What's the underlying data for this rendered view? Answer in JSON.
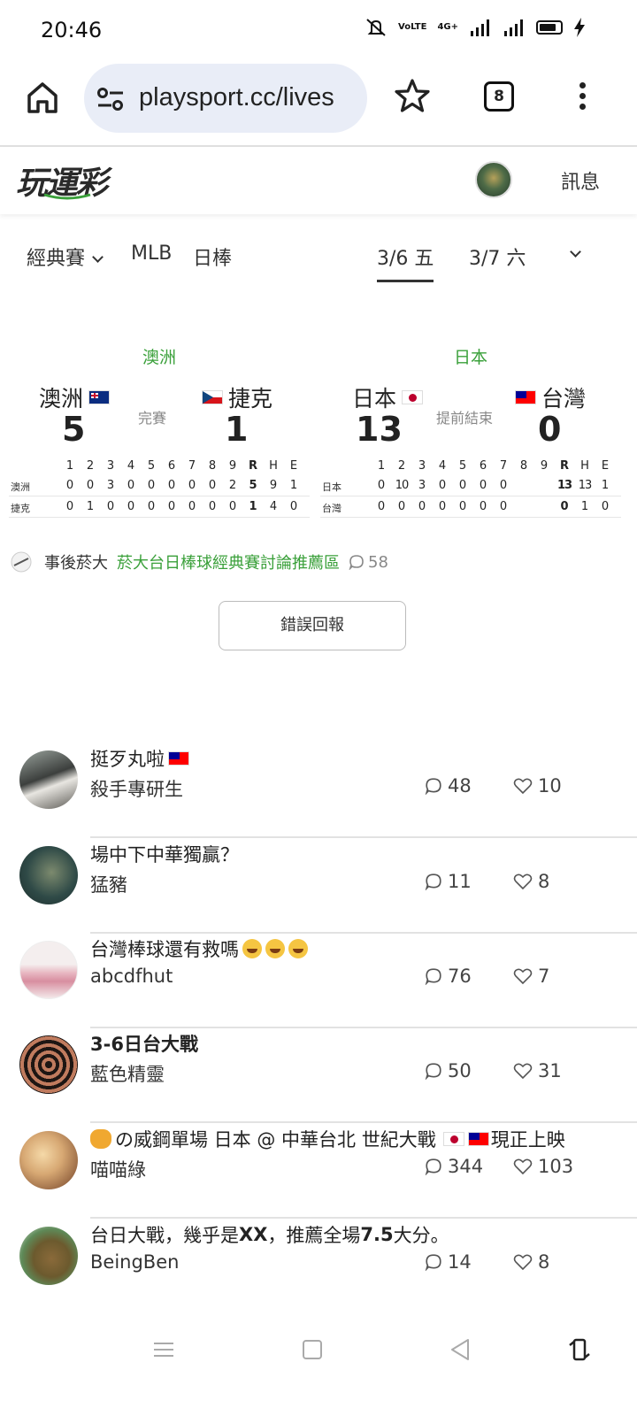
{
  "status": {
    "time": "20:46",
    "network_a": "VoLTE",
    "network_b": "4G+"
  },
  "browser": {
    "url": "playsport.cc/lives",
    "tab_count": "8"
  },
  "site": {
    "logo": "玩運彩",
    "messages_label": "訊息"
  },
  "filters": {
    "league": "經典賽",
    "mlb": "MLB",
    "npb": "日棒",
    "date_active": "3/6 五",
    "date_next": "3/7 六"
  },
  "games": [
    {
      "league": "澳洲",
      "away": "澳洲",
      "home": "捷克",
      "away_score": "5",
      "home_score": "1",
      "status": "完賽",
      "innings": [
        "1",
        "2",
        "3",
        "4",
        "5",
        "6",
        "7",
        "8",
        "9",
        "R",
        "H",
        "E"
      ],
      "away_short": "澳洲",
      "home_short": "捷克",
      "away_line": [
        "0",
        "0",
        "3",
        "0",
        "0",
        "0",
        "0",
        "0",
        "2",
        "5",
        "9",
        "1"
      ],
      "home_line": [
        "0",
        "1",
        "0",
        "0",
        "0",
        "0",
        "0",
        "0",
        "0",
        "1",
        "4",
        "0"
      ]
    },
    {
      "league": "日本",
      "away": "日本",
      "home": "台灣",
      "away_score": "13",
      "home_score": "0",
      "status": "提前結束",
      "innings": [
        "1",
        "2",
        "3",
        "4",
        "5",
        "6",
        "7",
        "8",
        "9",
        "R",
        "H",
        "E"
      ],
      "away_short": "日本",
      "home_short": "台灣",
      "away_line": [
        "0",
        "10",
        "3",
        "0",
        "0",
        "0",
        "0",
        "",
        "",
        "13",
        "13",
        "1"
      ],
      "home_line": [
        "0",
        "0",
        "0",
        "0",
        "0",
        "0",
        "0",
        "",
        "",
        "0",
        "1",
        "0"
      ]
    }
  ],
  "discussion": {
    "author": "事後菸大",
    "link": "菸大台日棒球經典賽討論推薦區",
    "count": "58"
  },
  "report_button": "錯誤回報",
  "posts": [
    {
      "title": "挺歹丸啦",
      "user": "殺手專研生",
      "comments": "48",
      "likes": "10"
    },
    {
      "title": "場中下中華獨贏？",
      "user": "猛豬",
      "comments": "11",
      "likes": "8"
    },
    {
      "title": "台灣棒球還有救嗎",
      "user": "abcdfhut",
      "comments": "76",
      "likes": "7"
    },
    {
      "title": "3-6日台大戰",
      "user": "藍色精靈",
      "comments": "50",
      "likes": "31"
    },
    {
      "title_a": "の威鋼單場 日本 @ 中華台北 世紀大戰",
      "title_b": "現正上映",
      "user": "喵喵綠",
      "comments": "344",
      "likes": "103"
    },
    {
      "title_a": "台日大戰，幾乎是",
      "title_bold": "XX",
      "title_b": "，推薦全場",
      "title_bold2": "7.5",
      "title_c": "大分。",
      "user": "BeingBen",
      "comments": "14",
      "likes": "8"
    }
  ],
  "colors": {
    "accent_green": "#3aa03a",
    "url_bg": "#e9edf7"
  }
}
